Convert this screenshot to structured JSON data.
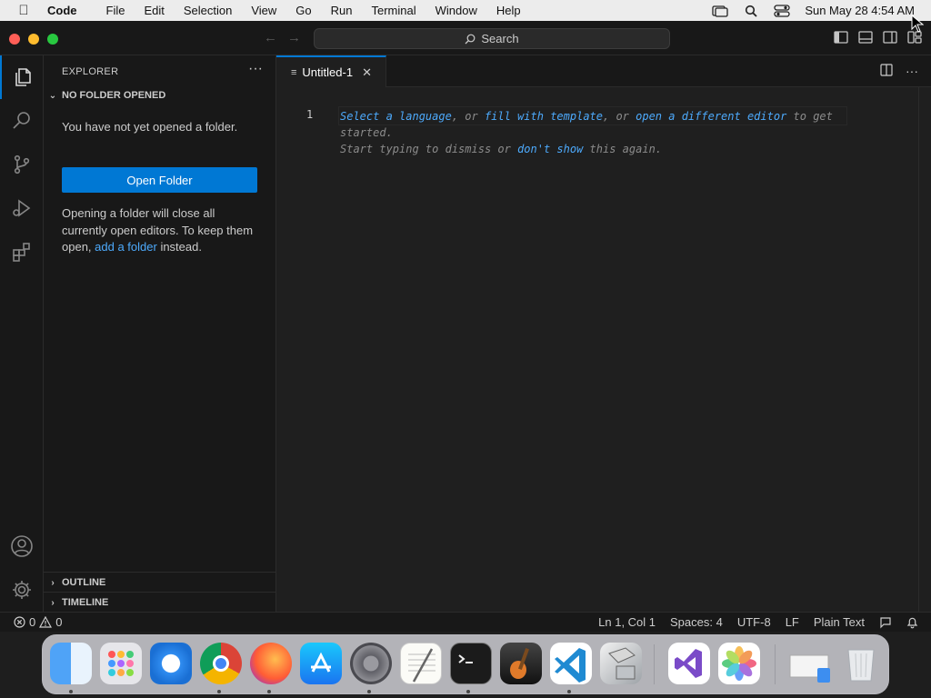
{
  "menubar": {
    "app_name": "Code",
    "items": [
      "File",
      "Edit",
      "Selection",
      "View",
      "Go",
      "Run",
      "Terminal",
      "Window",
      "Help"
    ],
    "clock": "Sun May 28  4:54 AM"
  },
  "titlebar": {
    "search_label": "Search"
  },
  "activity_bar": {
    "items": [
      "explorer-icon",
      "search-icon",
      "source-control-icon",
      "run-debug-icon",
      "extensions-icon"
    ],
    "bottom": [
      "accounts-icon",
      "manage-gear-icon"
    ]
  },
  "sidebar": {
    "title": "EXPLORER",
    "section_title": "NO FOLDER OPENED",
    "message": "You have not yet opened a folder.",
    "open_folder_label": "Open Folder",
    "info_before": "Opening a folder will close all currently open editors. To keep them open, ",
    "info_link": "add a folder",
    "info_after": " instead.",
    "outline_label": "OUTLINE",
    "timeline_label": "TIMELINE"
  },
  "editor": {
    "tab_label": "Untitled-1",
    "line_number": "1",
    "hint": {
      "link1": "Select a language",
      "sep1": ", or ",
      "link2": "fill with template",
      "sep2": ", or ",
      "link3": "open a different editor",
      "after3": " to get started.",
      "line2_before": "Start typing to dismiss or ",
      "link4": "don't show",
      "line2_after": " this again."
    }
  },
  "statusbar": {
    "errors": "0",
    "warnings": "0",
    "position": "Ln 1, Col 1",
    "spaces": "Spaces: 4",
    "encoding": "UTF-8",
    "eol": "LF",
    "language": "Plain Text"
  },
  "dock": {
    "apps": [
      "Finder",
      "Launchpad",
      "Safari",
      "Chrome",
      "Firefox",
      "App Store",
      "System Preferences",
      "TextEdit",
      "Terminal",
      "GarageBand",
      "Visual Studio Code",
      "Utility",
      "Visual Studio",
      "Photos",
      "Downloads",
      "Trash"
    ]
  }
}
